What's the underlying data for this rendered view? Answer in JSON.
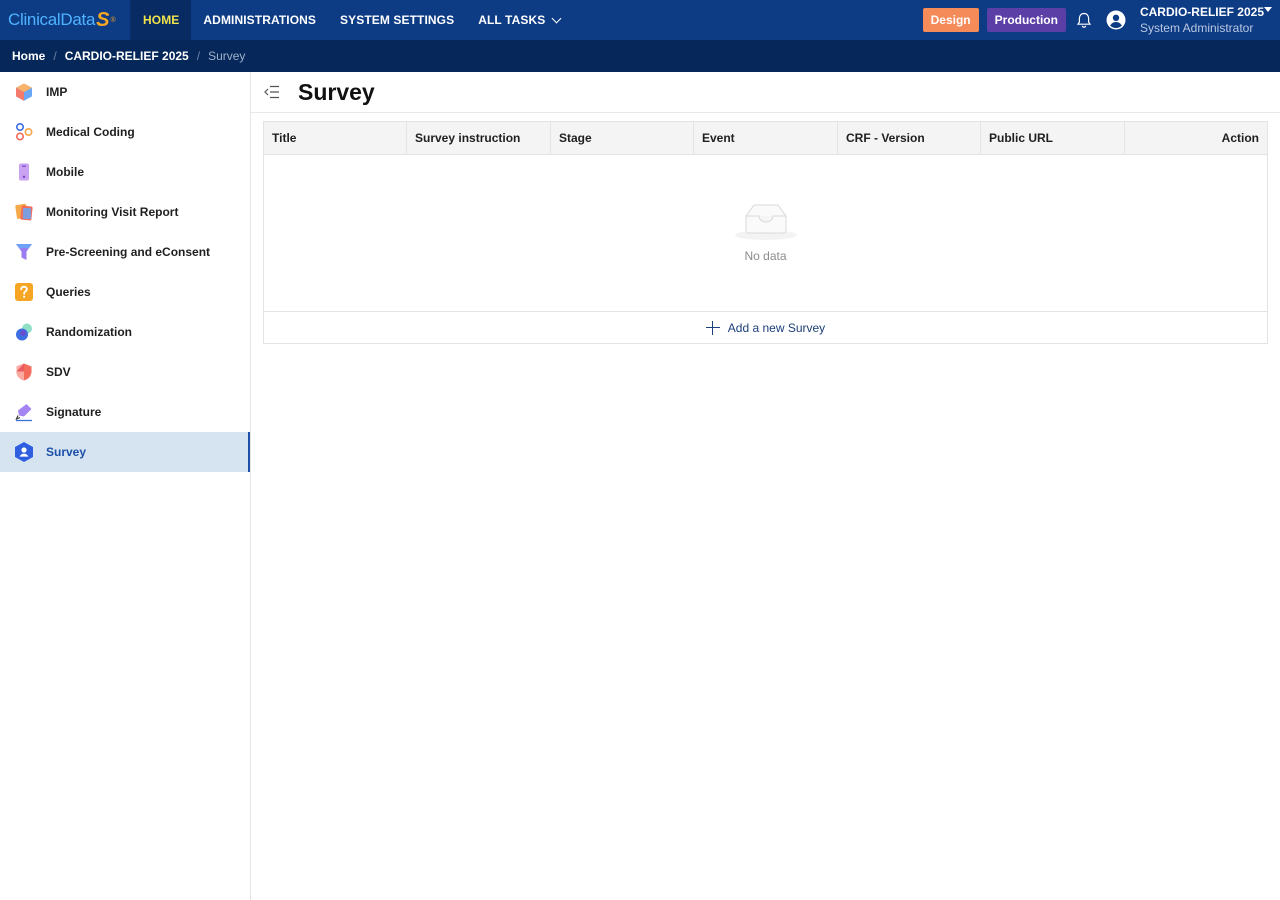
{
  "app": {
    "logo_text": "ClinicalData",
    "logo_mark": "S",
    "logo_reg": "®"
  },
  "topnav": [
    {
      "label": "HOME",
      "active": true
    },
    {
      "label": "ADMINISTRATIONS",
      "active": false
    },
    {
      "label": "SYSTEM SETTINGS",
      "active": false
    },
    {
      "label": "ALL TASKS",
      "active": false,
      "dropdown": true
    }
  ],
  "env": {
    "design": "Design",
    "production": "Production"
  },
  "user": {
    "study": "CARDIO-RELIEF 2025",
    "role": "System Administrator"
  },
  "breadcrumb": {
    "home": "Home",
    "study": "CARDIO-RELIEF 2025",
    "current": "Survey",
    "sep": "/"
  },
  "sidebar": {
    "items": [
      {
        "label": "IMP",
        "icon": "imp-cube-icon"
      },
      {
        "label": "Medical Coding",
        "icon": "medical-coding-icon"
      },
      {
        "label": "Mobile",
        "icon": "mobile-icon"
      },
      {
        "label": "Monitoring Visit Report",
        "icon": "monitoring-report-icon"
      },
      {
        "label": "Pre-Screening and eConsent",
        "icon": "funnel-icon"
      },
      {
        "label": "Queries",
        "icon": "question-icon"
      },
      {
        "label": "Randomization",
        "icon": "randomization-icon"
      },
      {
        "label": "SDV",
        "icon": "shield-icon"
      },
      {
        "label": "Signature",
        "icon": "signature-pen-icon"
      },
      {
        "label": "Survey",
        "icon": "survey-user-icon",
        "active": true
      }
    ]
  },
  "page": {
    "title": "Survey"
  },
  "table": {
    "columns": [
      "Title",
      "Survey instruction",
      "Stage",
      "Event",
      "CRF - Version",
      "Public URL",
      "Action"
    ],
    "empty_text": "No data",
    "add_label": "Add a new Survey"
  },
  "colors": {
    "topbar": "#0d3b84",
    "breadcrumb_bar": "#06275a",
    "active_nav_text": "#f2e34a",
    "design_badge": "#f68b5a",
    "production_badge": "#5b3fa7",
    "sidebar_active_bg": "#d6e4f2",
    "sidebar_active_text": "#1c4fa8"
  }
}
